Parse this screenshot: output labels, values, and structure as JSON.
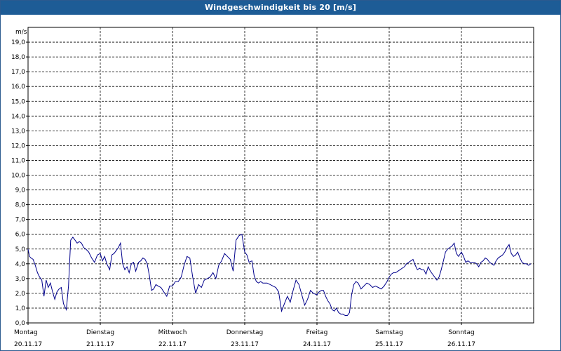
{
  "window": {
    "title": "Windgeschwindigkeit bis 20 [m/s]"
  },
  "chart_data": {
    "type": "line",
    "title": "Windgeschwindigkeit bis 20 [m/s]",
    "ylabel": "m/s",
    "ylim": [
      0,
      20
    ],
    "y_ticks": [
      "0,0",
      "1,0",
      "2,0",
      "3,0",
      "4,0",
      "5,0",
      "6,0",
      "7,0",
      "8,0",
      "9,0",
      "10,0",
      "11,0",
      "12,0",
      "13,0",
      "14,0",
      "15,0",
      "16,0",
      "17,0",
      "18,0",
      "19,0"
    ],
    "x_ticks": [
      {
        "day": "Montag",
        "date": "20.11.17"
      },
      {
        "day": "Dienstag",
        "date": "21.11.17"
      },
      {
        "day": "Mittwoch",
        "date": "22.11.17"
      },
      {
        "day": "Donnerstag",
        "date": "23.11.17"
      },
      {
        "day": "Freitag",
        "date": "24.11.17"
      },
      {
        "day": "Samstag",
        "date": "25.11.17"
      },
      {
        "day": "Sonntag",
        "date": "26.11.17"
      }
    ],
    "grid": true,
    "line_color": "#00008b",
    "series": [
      {
        "x": [
          0.0,
          0.02,
          0.04,
          0.07,
          0.1,
          0.13,
          0.16,
          0.19,
          0.22,
          0.25,
          0.28,
          0.31,
          0.34,
          0.37,
          0.4,
          0.43,
          0.46,
          0.49,
          0.53,
          0.56,
          0.59,
          0.62,
          0.65,
          0.68,
          0.71,
          0.74,
          0.77,
          0.8,
          0.84,
          0.88,
          0.92,
          0.96,
          1.0,
          1.03,
          1.06,
          1.09,
          1.13,
          1.16,
          1.19,
          1.22,
          1.25,
          1.28,
          1.31,
          1.34,
          1.37,
          1.4,
          1.43,
          1.46,
          1.49,
          1.53,
          1.56,
          1.59,
          1.62,
          1.65,
          1.68,
          1.71,
          1.74,
          1.77,
          1.8,
          1.84,
          1.88,
          1.92,
          1.96,
          2.0,
          2.04,
          2.08,
          2.12,
          2.16,
          2.2,
          2.24,
          2.28,
          2.32,
          2.36,
          2.4,
          2.44,
          2.48,
          2.52,
          2.56,
          2.6,
          2.64,
          2.68,
          2.72,
          2.76,
          2.8,
          2.84,
          2.88,
          2.92,
          2.96,
          3.0,
          3.03,
          3.06,
          3.1,
          3.13,
          3.16,
          3.19,
          3.22,
          3.25,
          3.28,
          3.31,
          3.35,
          3.39,
          3.43,
          3.47,
          3.51,
          3.55,
          3.59,
          3.63,
          3.67,
          3.71,
          3.75,
          3.79,
          3.83,
          3.87,
          3.91,
          3.95,
          4.0,
          4.03,
          4.06,
          4.09,
          4.12,
          4.15,
          4.18,
          4.21,
          4.24,
          4.27,
          4.3,
          4.33,
          4.36,
          4.39,
          4.42,
          4.45,
          4.48,
          4.51,
          4.54,
          4.57,
          4.61,
          4.65,
          4.69,
          4.73,
          4.77,
          4.81,
          4.85,
          4.89,
          4.93,
          4.97,
          5.0,
          5.03,
          5.06,
          5.09,
          5.12,
          5.15,
          5.18,
          5.21,
          5.24,
          5.27,
          5.3,
          5.33,
          5.36,
          5.39,
          5.42,
          5.45,
          5.48,
          5.51,
          5.54,
          5.57,
          5.6,
          5.63,
          5.66,
          5.69,
          5.72,
          5.75,
          5.78,
          5.81,
          5.84,
          5.87,
          5.9,
          5.93,
          5.96,
          6.0,
          6.03,
          6.06,
          6.09,
          6.12,
          6.15,
          6.18,
          6.21,
          6.24,
          6.27,
          6.3,
          6.33,
          6.36,
          6.39,
          6.42,
          6.45,
          6.48,
          6.51,
          6.54,
          6.57,
          6.6,
          6.63,
          6.66,
          6.69,
          6.72,
          6.75,
          6.78,
          6.81,
          6.84,
          6.87,
          6.9,
          6.93,
          6.96
        ],
        "y": [
          5.0,
          4.5,
          4.4,
          4.3,
          3.9,
          3.4,
          3.1,
          2.9,
          1.8,
          2.9,
          2.4,
          2.7,
          2.1,
          1.6,
          2.1,
          2.3,
          2.4,
          1.3,
          0.9,
          2.5,
          5.6,
          5.8,
          5.6,
          5.4,
          5.5,
          5.4,
          5.1,
          5.0,
          4.8,
          4.4,
          4.1,
          4.6,
          4.7,
          4.2,
          4.5,
          4.0,
          3.6,
          4.6,
          4.7,
          4.9,
          5.1,
          5.4,
          4.0,
          3.6,
          3.8,
          3.4,
          4.0,
          4.1,
          3.5,
          4.1,
          4.2,
          4.4,
          4.3,
          4.0,
          3.2,
          2.2,
          2.3,
          2.6,
          2.5,
          2.4,
          2.1,
          1.8,
          2.5,
          2.5,
          2.8,
          2.8,
          3.1,
          3.9,
          4.5,
          4.4,
          3.1,
          2.0,
          2.6,
          2.4,
          2.9,
          3.0,
          3.1,
          3.4,
          3.0,
          3.9,
          4.2,
          4.7,
          4.5,
          4.3,
          3.5,
          5.6,
          5.9,
          6.0,
          4.8,
          4.6,
          4.1,
          4.2,
          3.2,
          2.8,
          2.7,
          2.8,
          2.7,
          2.7,
          2.7,
          2.6,
          2.5,
          2.4,
          2.1,
          0.8,
          1.3,
          1.8,
          1.4,
          2.2,
          2.9,
          2.6,
          1.9,
          1.2,
          1.6,
          2.2,
          2.0,
          1.9,
          2.1,
          2.2,
          2.2,
          1.8,
          1.5,
          1.3,
          0.9,
          0.8,
          1.0,
          0.7,
          0.6,
          0.6,
          0.5,
          0.5,
          0.7,
          1.9,
          2.6,
          2.8,
          2.7,
          2.3,
          2.5,
          2.7,
          2.6,
          2.4,
          2.5,
          2.4,
          2.3,
          2.5,
          2.8,
          3.1,
          3.3,
          3.4,
          3.4,
          3.5,
          3.6,
          3.7,
          3.8,
          4.0,
          4.1,
          4.2,
          4.3,
          3.9,
          3.6,
          3.7,
          3.6,
          3.6,
          3.3,
          3.8,
          3.5,
          3.3,
          3.1,
          2.9,
          3.1,
          3.6,
          4.2,
          4.8,
          5.0,
          5.1,
          5.2,
          5.4,
          4.7,
          4.5,
          4.8,
          4.5,
          4.1,
          4.2,
          4.1,
          4.1,
          4.1,
          4.0,
          3.8,
          4.1,
          4.2,
          4.4,
          4.3,
          4.1,
          4.0,
          3.9,
          4.2,
          4.4,
          4.5,
          4.6,
          4.8,
          5.1,
          5.3,
          4.7,
          4.5,
          4.6,
          4.8,
          4.4,
          4.1,
          4.0,
          4.0,
          3.9,
          4.0
        ]
      }
    ]
  }
}
